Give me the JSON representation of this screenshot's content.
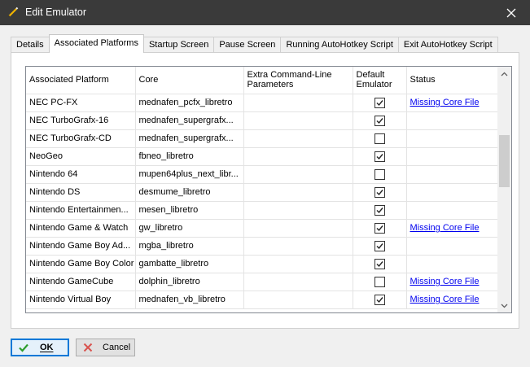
{
  "window": {
    "title": "Edit Emulator",
    "icon": "pencil-icon",
    "close_icon": "close-icon"
  },
  "tabs": [
    {
      "label": "Details",
      "active": false
    },
    {
      "label": "Associated Platforms",
      "active": true
    },
    {
      "label": "Startup Screen",
      "active": false
    },
    {
      "label": "Pause Screen",
      "active": false
    },
    {
      "label": "Running AutoHotkey Script",
      "active": false
    },
    {
      "label": "Exit AutoHotkey Script",
      "active": false
    }
  ],
  "grid": {
    "columns": [
      "Associated Platform",
      "Core",
      "Extra Command-Line Parameters",
      "Default Emulator",
      "Status"
    ],
    "rows": [
      {
        "platform": "NEC PC-FX",
        "core": "mednafen_pcfx_libretro",
        "params": "",
        "default": true,
        "status": "Missing Core File"
      },
      {
        "platform": "NEC TurboGrafx-16",
        "core": "mednafen_supergrafx...",
        "params": "",
        "default": true,
        "status": ""
      },
      {
        "platform": "NEC TurboGrafx-CD",
        "core": "mednafen_supergrafx...",
        "params": "",
        "default": false,
        "status": ""
      },
      {
        "platform": "NeoGeo",
        "core": "fbneo_libretro",
        "params": "",
        "default": true,
        "status": ""
      },
      {
        "platform": "Nintendo 64",
        "core": "mupen64plus_next_libr...",
        "params": "",
        "default": false,
        "status": ""
      },
      {
        "platform": "Nintendo DS",
        "core": "desmume_libretro",
        "params": "",
        "default": true,
        "status": ""
      },
      {
        "platform": "Nintendo Entertainmen...",
        "core": "mesen_libretro",
        "params": "",
        "default": true,
        "status": ""
      },
      {
        "platform": "Nintendo Game & Watch",
        "core": "gw_libretro",
        "params": "",
        "default": true,
        "status": "Missing Core File"
      },
      {
        "platform": "Nintendo Game Boy Ad...",
        "core": "mgba_libretro",
        "params": "",
        "default": true,
        "status": ""
      },
      {
        "platform": "Nintendo Game Boy Color",
        "core": "gambatte_libretro",
        "params": "",
        "default": true,
        "status": ""
      },
      {
        "platform": "Nintendo GameCube",
        "core": "dolphin_libretro",
        "params": "",
        "default": false,
        "status": "Missing Core File"
      },
      {
        "platform": "Nintendo Virtual Boy",
        "core": "mednafen_vb_libretro",
        "params": "",
        "default": true,
        "status": "Missing Core File"
      }
    ]
  },
  "buttons": {
    "ok": {
      "label": "OK",
      "icon": "checkmark-icon",
      "color": "#0078d7"
    },
    "cancel": {
      "label": "Cancel",
      "icon": "cancel-icon"
    }
  }
}
